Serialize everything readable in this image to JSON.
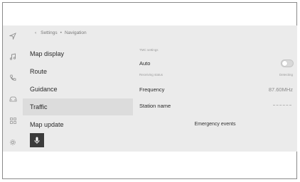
{
  "breadcrumb": {
    "back": "‹",
    "parent": "Settings",
    "separator": "•",
    "current": "Navigation"
  },
  "sidebar_icons": [
    "navigation-arrow-icon",
    "music-note-icon",
    "phone-icon",
    "car-icon",
    "apps-grid-icon",
    "gear-icon"
  ],
  "menu": {
    "items": [
      {
        "label": "Map display"
      },
      {
        "label": "Route"
      },
      {
        "label": "Guidance"
      },
      {
        "label": "Traffic",
        "active": true
      },
      {
        "label": "Map update"
      }
    ]
  },
  "voice_button": {
    "icon": "microphone-icon"
  },
  "panel": {
    "tmc_settings": "TMC settings",
    "auto_label": "Auto",
    "auto_enabled": false,
    "receiving_status_label": "Receiving status",
    "receiving_status_value": "Detecting",
    "frequency_label": "Frequency",
    "frequency_value": "87.60MHz",
    "station_name_label": "Station name",
    "emergency_events": "Emergency events"
  },
  "colors": {
    "screen_bg": "#ebebeb",
    "active_item": "#dcdcdc",
    "mic_bg": "#3c3c3c"
  }
}
